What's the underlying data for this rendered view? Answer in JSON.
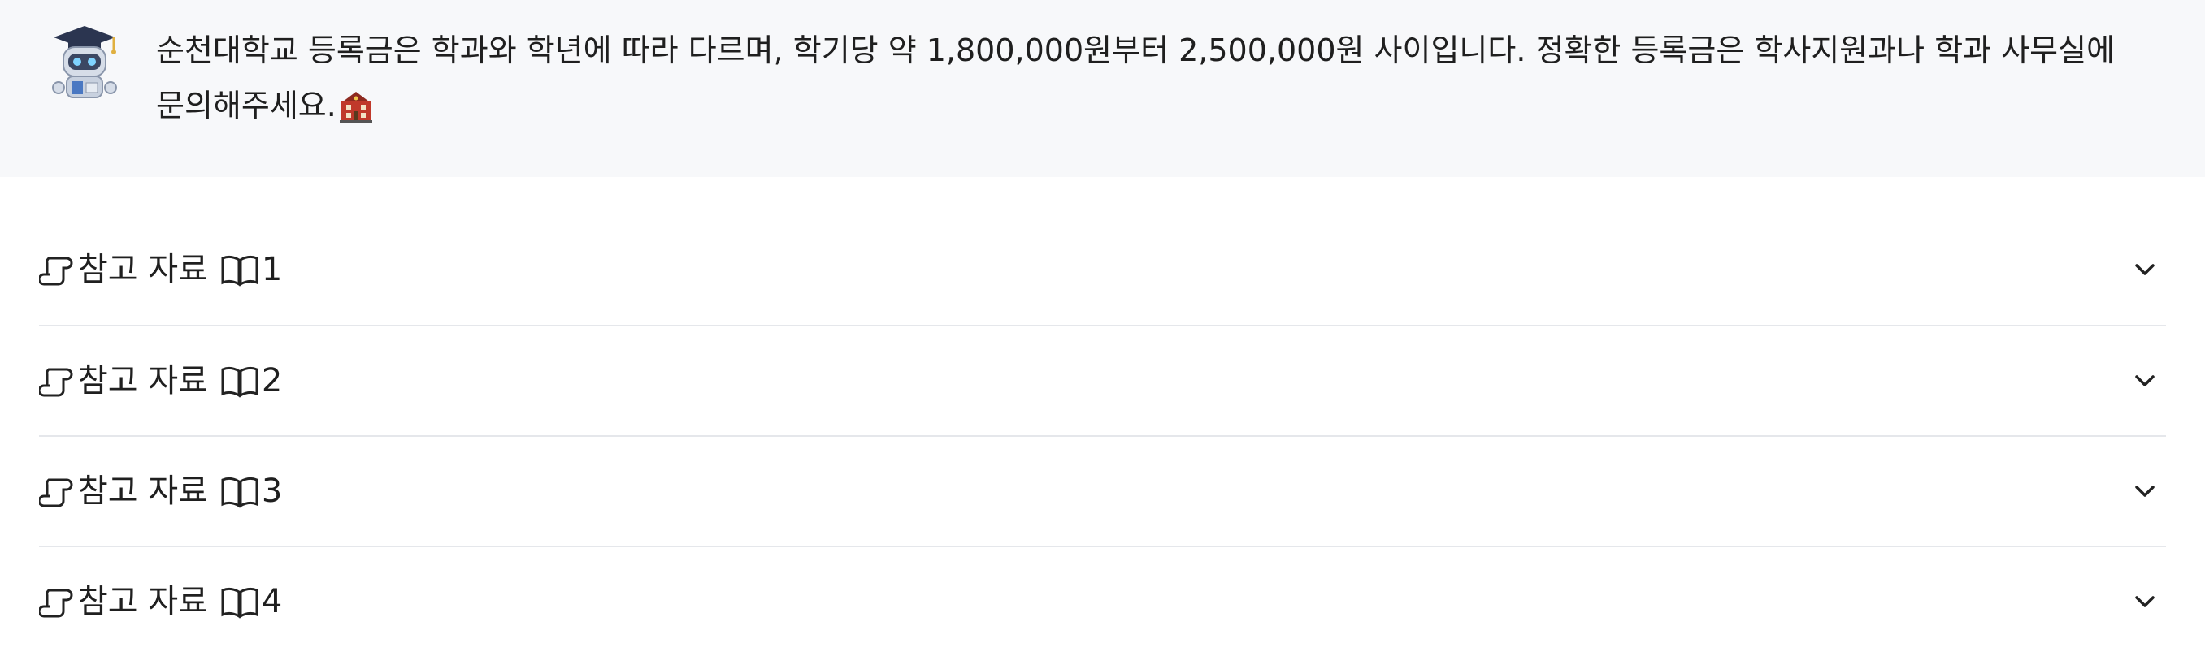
{
  "message": {
    "avatar_icon": "robot-graduate-icon",
    "text": "순천대학교 등록금은 학과와 학년에 따라 다르며, 학기당 약 1,800,000원부터 2,500,000원 사이입니다. 정확한 등록금은 학사지원과나 학과 사무실에 문의해주세요.",
    "trailing_emoji": "school-building-icon"
  },
  "references": {
    "prefix_icon": "scroll-icon",
    "book_icon": "open-book-icon",
    "toggle_icon": "chevron-down-icon",
    "items": [
      {
        "label": "참고 자료",
        "number": "1"
      },
      {
        "label": "참고 자료",
        "number": "2"
      },
      {
        "label": "참고 자료",
        "number": "3"
      },
      {
        "label": "참고 자료",
        "number": "4"
      }
    ]
  },
  "colors": {
    "message_bg": "#f7f8fa",
    "divider": "#e5e7eb",
    "text": "#1f1f1f"
  }
}
